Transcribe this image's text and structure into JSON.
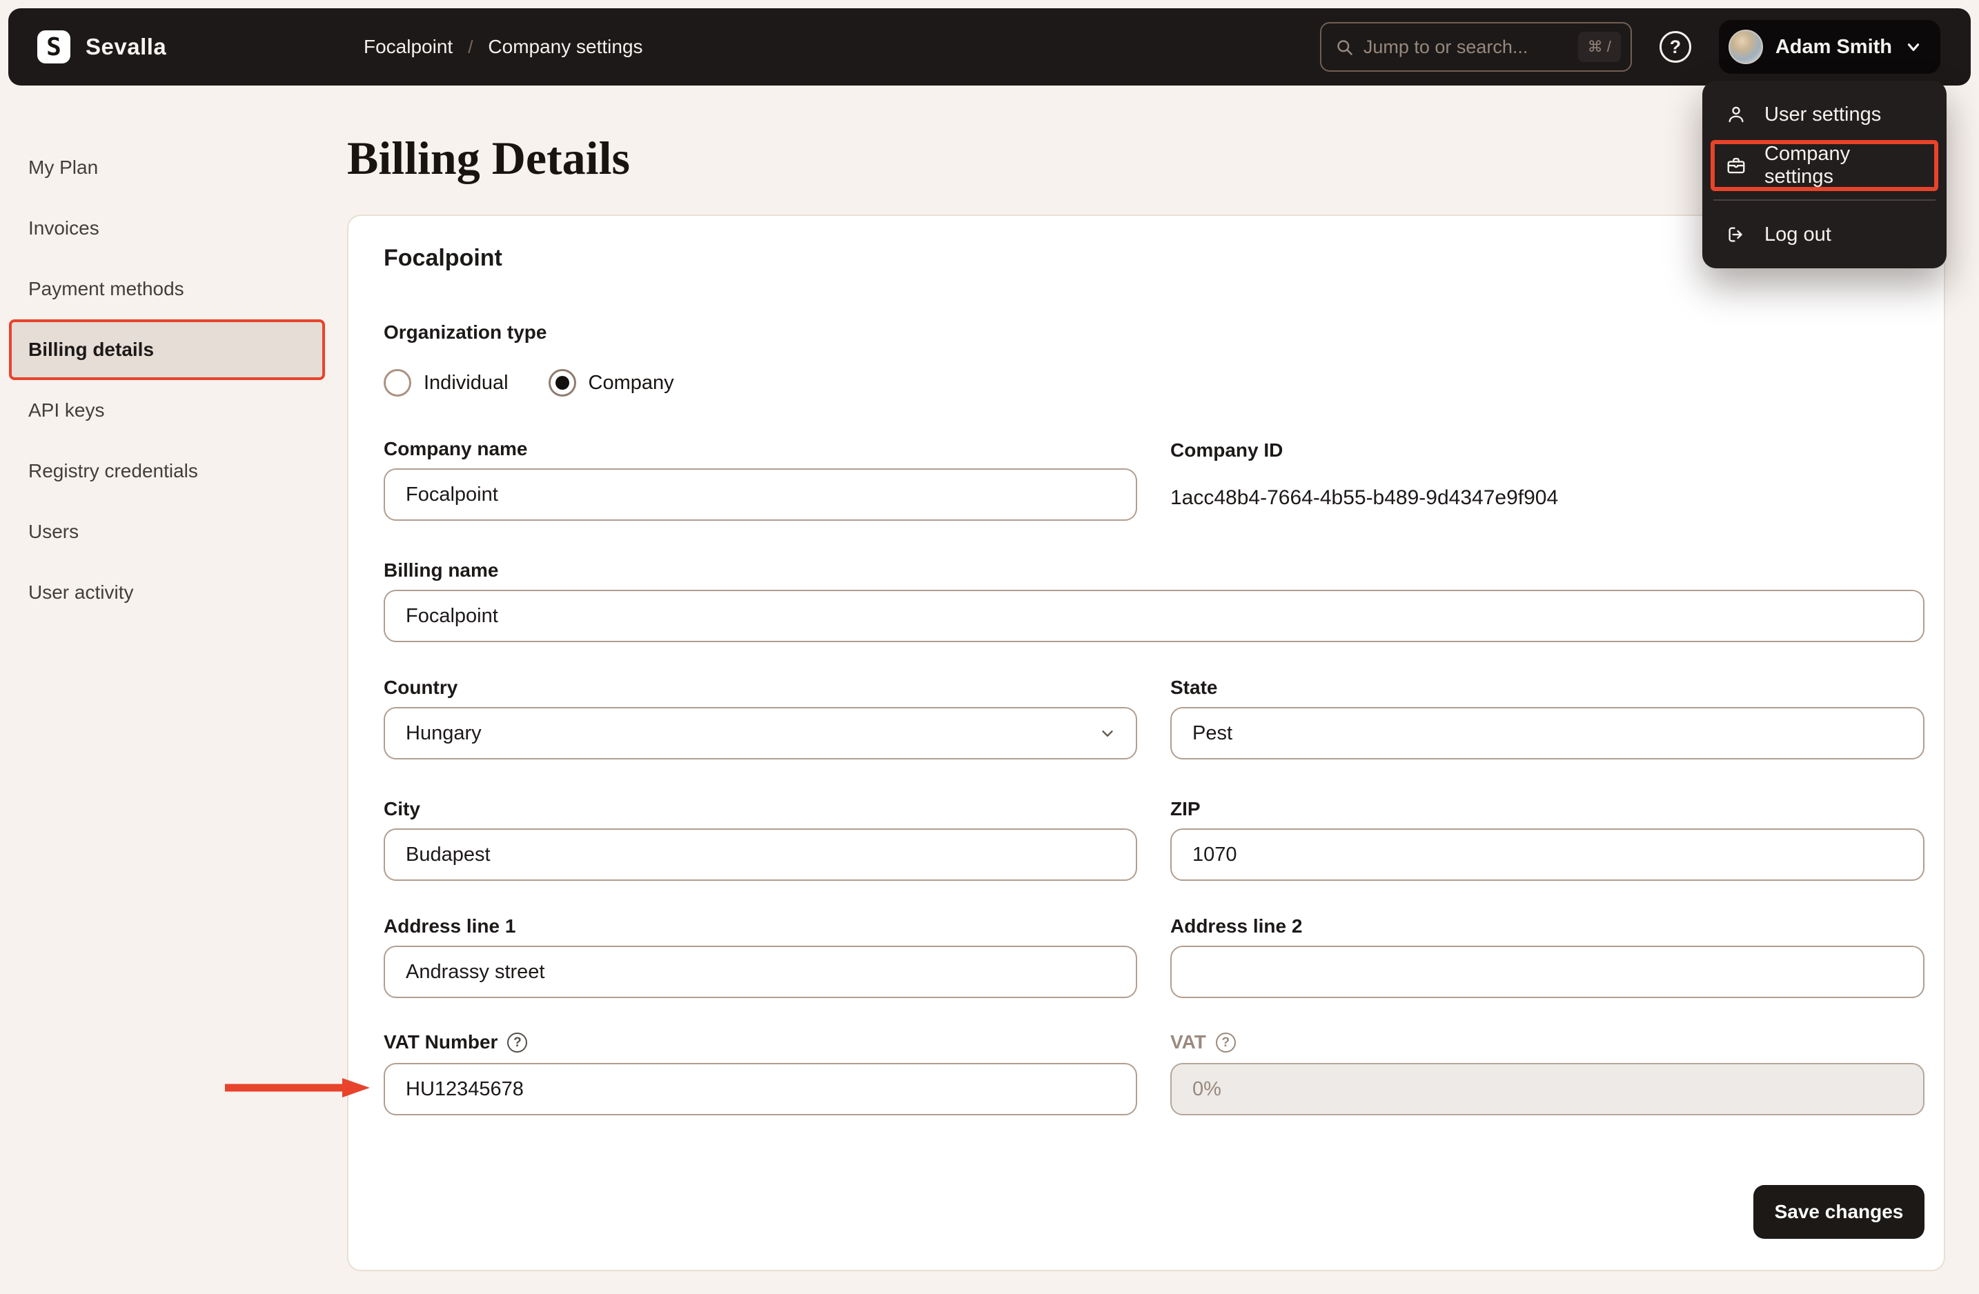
{
  "colors": {
    "accent_red": "#E8432B",
    "topbar_bg": "#1C1918",
    "menu_bg": "#221E1D",
    "page_bg": "#F7F2EE",
    "card_bg": "#FFFFFF",
    "input_border": "#B19E90",
    "active_nav_bg": "#E5DDD6",
    "save_button_bg": "#1C1917"
  },
  "icons": {
    "question_mark": "?",
    "logo_letter": "S"
  },
  "topbar": {
    "brand": "Sevalla",
    "breadcrumb": {
      "items": [
        "Focalpoint",
        "Company settings"
      ],
      "separator": "/"
    },
    "search": {
      "placeholder": "Jump to or search...",
      "shortcut": "⌘ /"
    },
    "user": {
      "name": "Adam Smith"
    }
  },
  "user_menu": {
    "items": [
      {
        "label": "User settings",
        "icon": "user-icon",
        "highlighted": false
      },
      {
        "label": "Company settings",
        "icon": "briefcase-icon",
        "highlighted": true
      },
      {
        "label": "Log out",
        "icon": "logout-icon",
        "highlighted": false
      }
    ]
  },
  "sidebar": {
    "items": [
      {
        "label": "My Plan",
        "active": false
      },
      {
        "label": "Invoices",
        "active": false
      },
      {
        "label": "Payment methods",
        "active": false
      },
      {
        "label": "Billing details",
        "active": true
      },
      {
        "label": "API keys",
        "active": false
      },
      {
        "label": "Registry credentials",
        "active": false
      },
      {
        "label": "Users",
        "active": false
      },
      {
        "label": "User activity",
        "active": false
      }
    ]
  },
  "page": {
    "title": "Billing Details"
  },
  "form": {
    "card_title": "Focalpoint",
    "organization_type": {
      "label": "Organization type",
      "options": [
        {
          "label": "Individual",
          "selected": false
        },
        {
          "label": "Company",
          "selected": true
        }
      ]
    },
    "fields": {
      "company_name": {
        "label": "Company name",
        "value": "Focalpoint"
      },
      "company_id": {
        "label": "Company ID",
        "value": "1acc48b4-7664-4b55-b489-9d4347e9f904"
      },
      "billing_name": {
        "label": "Billing name",
        "value": "Focalpoint"
      },
      "country": {
        "label": "Country",
        "value": "Hungary"
      },
      "state": {
        "label": "State",
        "value": "Pest"
      },
      "city": {
        "label": "City",
        "value": "Budapest"
      },
      "zip": {
        "label": "ZIP",
        "value": "1070"
      },
      "address1": {
        "label": "Address line 1",
        "value": "Andrassy street"
      },
      "address2": {
        "label": "Address line 2",
        "value": ""
      },
      "vat_number": {
        "label": "VAT Number",
        "value": "HU12345678"
      },
      "vat": {
        "label": "VAT",
        "value": "0%",
        "disabled": true
      }
    },
    "save_button": "Save changes"
  }
}
